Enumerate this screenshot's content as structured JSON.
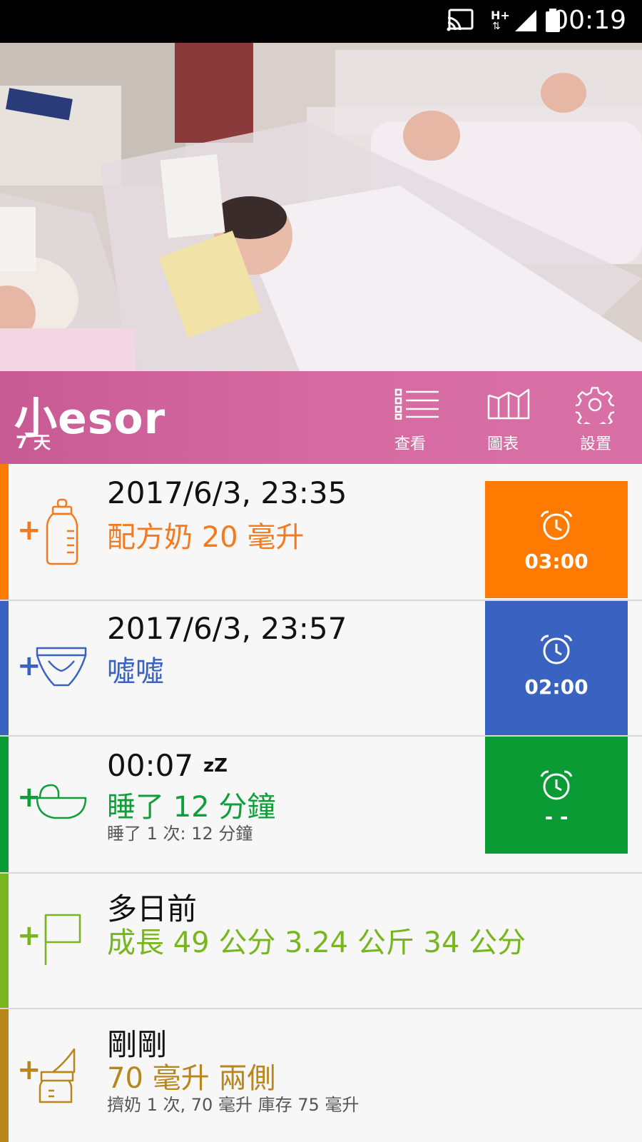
{
  "status_bar": {
    "time": "00:19",
    "network": "H+",
    "icons": [
      "cast-icon",
      "network-arrows-icon",
      "signal-icon",
      "battery-icon"
    ]
  },
  "header": {
    "baby_name": "小esor",
    "age": "7 天",
    "buttons": [
      {
        "label": "查看",
        "icon": "list-icon"
      },
      {
        "label": "圖表",
        "icon": "chart-icon"
      },
      {
        "label": "設置",
        "icon": "gear-icon"
      }
    ]
  },
  "entries": [
    {
      "when": "2017/6/3, 23:35",
      "what": "配方奶 20 毫升",
      "sub": "",
      "icon": "bottle-icon",
      "color": "#f47a20",
      "alarm": {
        "time": "03:00",
        "color": "#ff7a00"
      }
    },
    {
      "when": "2017/6/3, 23:57",
      "what": "噓噓",
      "sub": "",
      "icon": "diaper-icon",
      "color": "#3a62c0",
      "alarm": {
        "time": "02:00",
        "color": "#3a62c0"
      }
    },
    {
      "when": "00:07",
      "what": "睡了 12 分鐘",
      "sub": "睡了 1 次: 12 分鐘",
      "icon": "crib-icon",
      "color": "#0f9e3a",
      "sleep_marker": "zZ",
      "alarm": {
        "time": "- -",
        "color": "#0a9b35"
      }
    },
    {
      "when": "多日前",
      "what": "成長 49 公分 3.24 公斤 34 公分",
      "sub": "",
      "icon": "flag-icon",
      "color": "#77b61e"
    },
    {
      "when": "剛剛",
      "what": "70 毫升 兩側",
      "sub": "擠奶 1 次, 70 毫升 庫存 75 毫升",
      "icon": "breast-pump-icon",
      "color": "#b8861b"
    }
  ]
}
